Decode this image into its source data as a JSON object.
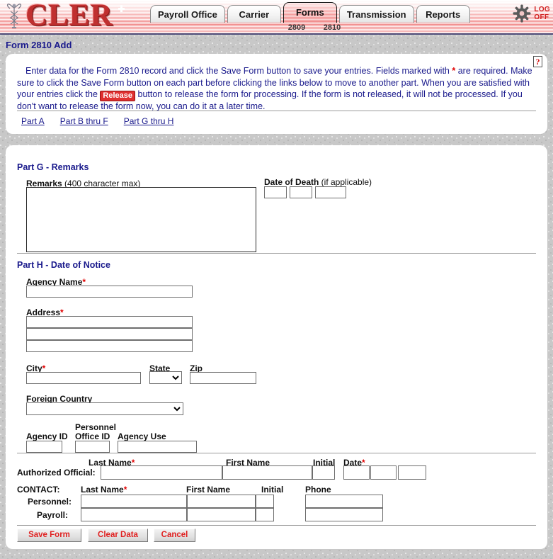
{
  "header": {
    "logo_text": "CLER",
    "logo_icon": "caduceus-icon",
    "tabs": [
      {
        "label": "Payroll Office",
        "active": false
      },
      {
        "label": "Carrier",
        "active": false
      },
      {
        "label": "Forms",
        "active": true
      },
      {
        "label": "Transmission",
        "active": false
      },
      {
        "label": "Reports",
        "active": false
      }
    ],
    "sub_tabs": [
      "2809",
      "2810"
    ],
    "logoff_line1": "LOG",
    "logoff_line2": "OFF"
  },
  "page_title": "Form 2810 Add",
  "instructions": {
    "text_1": "Enter data for the Form 2810 record and click the Save Form button to save your entries.  Fields marked with ",
    "star": "*",
    "text_2": " are required.  Make sure to click the Save Form button on each part before clicking the links below to move to another part.  When you are satisfied with your entries click the ",
    "release_chip": "Release",
    "text_3": " button to release the form for processing.  If the form is not released, it will not be processed.  If you don't want to release the form now, you can do it at a later time."
  },
  "part_links": [
    {
      "label": "Part A"
    },
    {
      "label": "Part B thru F"
    },
    {
      "label": "Part G thru H"
    }
  ],
  "part_g": {
    "title": "Part G - Remarks",
    "remarks_label_bold": "Remarks",
    "remarks_label_sub": " (400 character max)",
    "remarks_value": "",
    "date_of_death_label_bold": "Date of Death",
    "date_of_death_label_sub": " (if applicable)",
    "dod_month": "",
    "dod_day": "",
    "dod_year": ""
  },
  "part_h": {
    "title": "Part H - Date of Notice",
    "agency_name_label": "Agency Name",
    "agency_name_value": "",
    "address_label": "Address",
    "address_line1": "",
    "address_line2": "",
    "address_line3": "",
    "city_label": "City",
    "city_value": "",
    "state_label": "State",
    "state_value": "",
    "zip_label": "Zip",
    "zip_value": "",
    "foreign_country_label": "Foreign Country",
    "foreign_country_value": "",
    "agency_id_label": "Agency ID",
    "agency_id_value": "",
    "personnel_office_id_label_line1": "Personnel",
    "personnel_office_id_label_line2": "Office ID",
    "personnel_office_id_value": "",
    "agency_use_label": "Agency Use",
    "agency_use_value": ""
  },
  "authorized_official": {
    "row_label": "Authorized Official:",
    "last_name_label": "Last Name",
    "first_name_label": "First Name",
    "initial_label": "Initial",
    "date_label": "Date",
    "last_name_value": "",
    "first_name_value": "",
    "initial_value": "",
    "date_month": "",
    "date_day": "",
    "date_year": ""
  },
  "contact": {
    "section_label": "CONTACT:",
    "last_name_label": "Last Name",
    "first_name_label": "First Name",
    "initial_label": "Initial",
    "phone_label": "Phone",
    "personnel_row_label": "Personnel:",
    "payroll_row_label": "Payroll:",
    "personnel_last_name": "",
    "personnel_first_name": "",
    "personnel_initial": "",
    "personnel_phone": "",
    "payroll_last_name": "",
    "payroll_first_name": "",
    "payroll_initial": "",
    "payroll_phone": ""
  },
  "buttons": {
    "save": "Save Form",
    "clear": "Clear Data",
    "cancel": "Cancel"
  },
  "colors": {
    "title_blue": "#1a1a8c",
    "required_red": "#e00000",
    "button_red": "#e02020",
    "banner_pink": "#f08585"
  }
}
